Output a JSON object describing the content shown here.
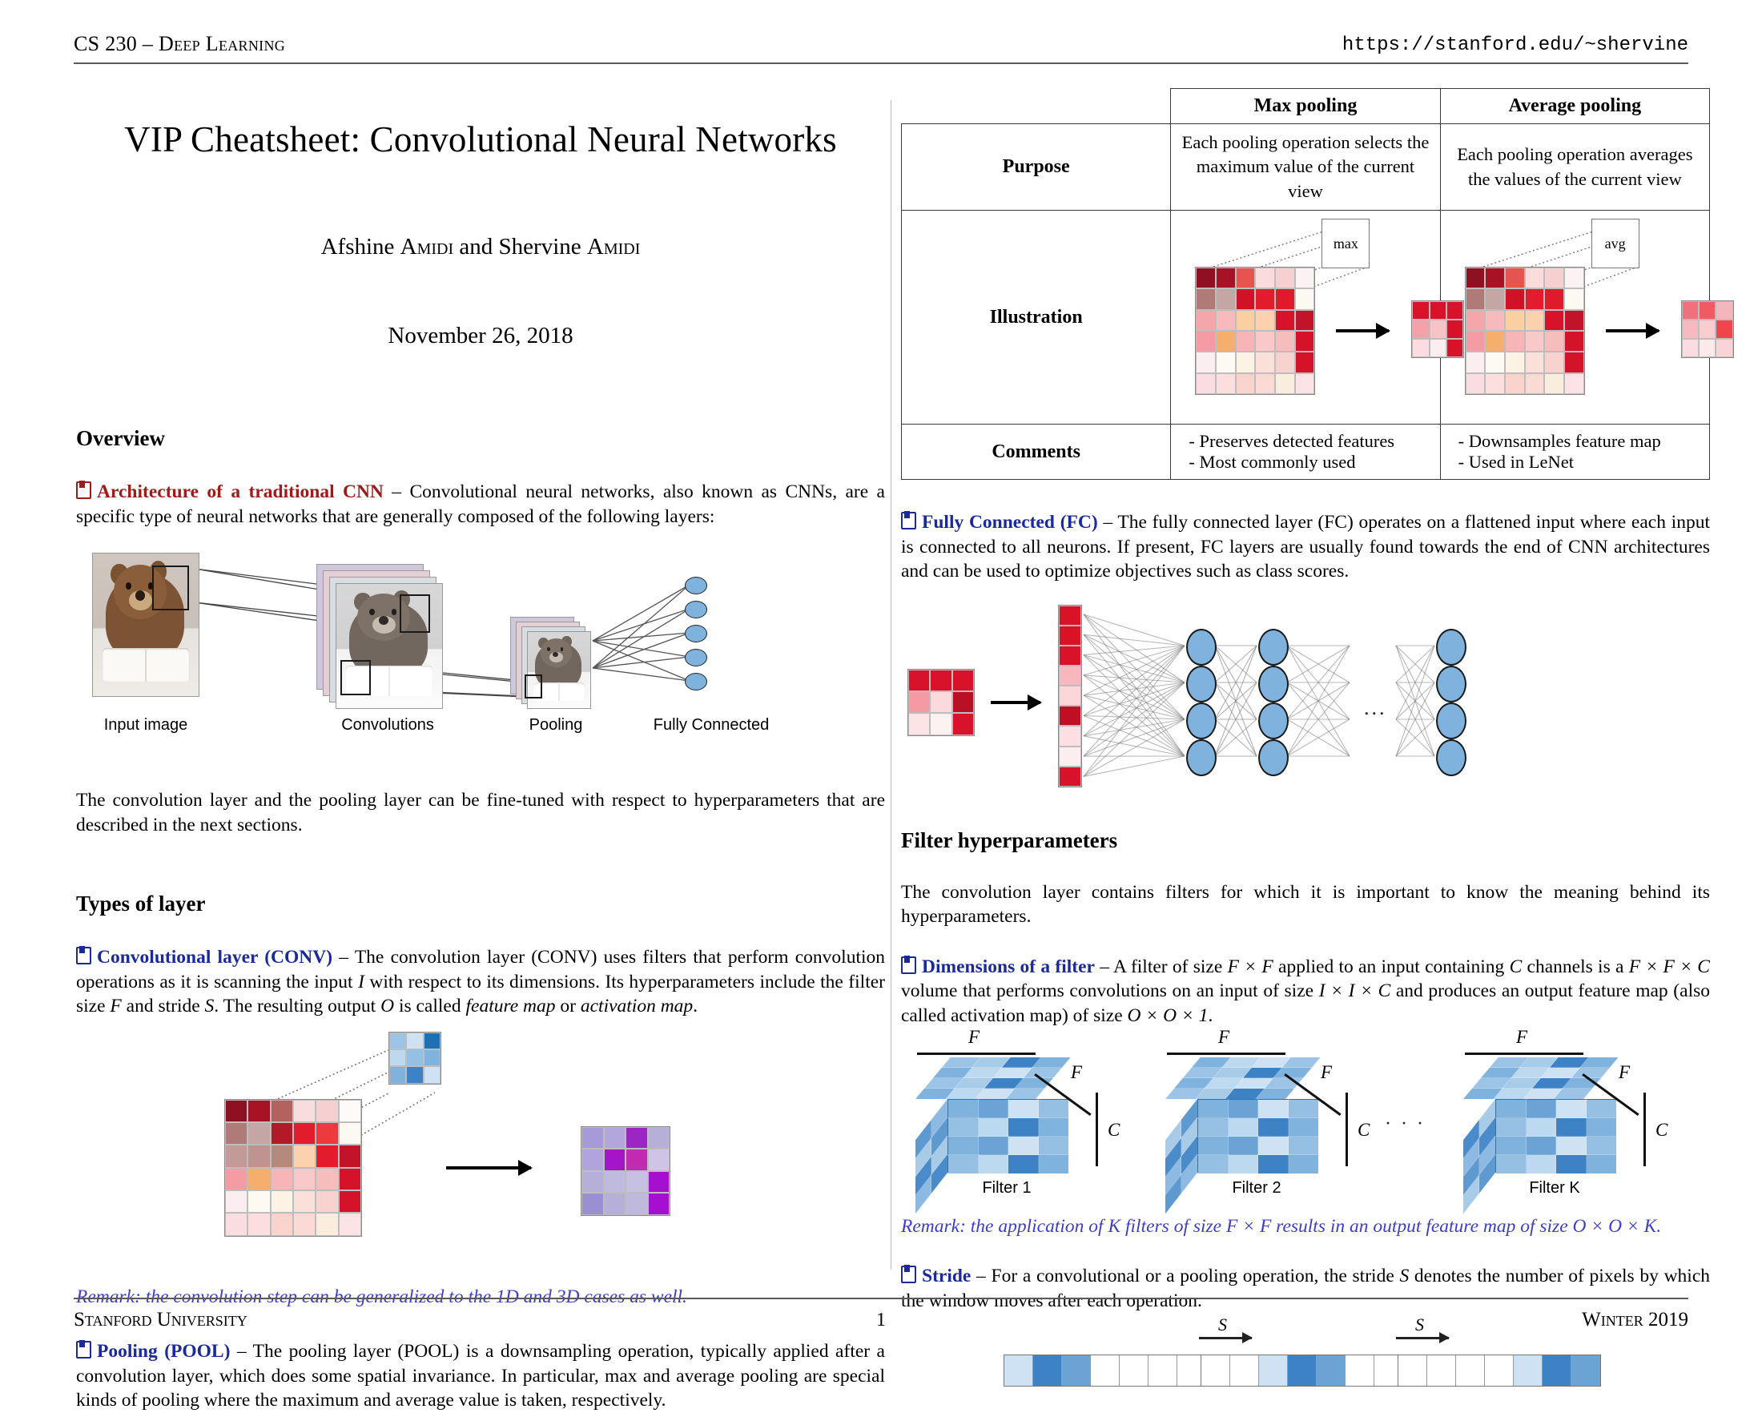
{
  "header": {
    "left": "CS 230 – Deep Learning",
    "right": "https://stanford.edu/~shervine"
  },
  "footer": {
    "left": "Stanford University",
    "page": "1",
    "right": "Winter 2019"
  },
  "title": {
    "main": "VIP Cheatsheet: Convolutional Neural Networks",
    "authors_pre": "Afshine ",
    "authors_name1": "Amidi",
    "authors_mid": " and Shervine ",
    "authors_name2": "Amidi",
    "date": "November 26, 2018"
  },
  "overview": {
    "heading": "Overview",
    "arch_kw": "Architecture of a traditional CNN",
    "arch_body": " – Convolutional neural networks, also known as CNNs, are a specific type of neural networks that are generally composed of the following layers:",
    "figure_labels": [
      "Input image",
      "Convolutions",
      "Pooling",
      "Fully Connected"
    ],
    "after_fig": "The convolution layer and the pooling layer can be fine-tuned with respect to hyperparameters that are described in the next sections."
  },
  "types_of_layer": {
    "heading": "Types of layer",
    "conv_kw": "Convolutional layer (CONV)",
    "conv_body_1": " – The convolution layer (CONV) uses filters that perform convolution operations as it is scanning the input ",
    "conv_I": "I",
    "conv_body_2": " with respect to its dimensions. Its hyperparameters include the filter size ",
    "conv_F": "F",
    "conv_body_3": " and stride ",
    "conv_S": "S",
    "conv_body_4": ". The resulting output ",
    "conv_O": "O",
    "conv_body_5": " is called ",
    "conv_em1": "feature map",
    "conv_body_6": " or ",
    "conv_em2": "activation map",
    "conv_body_7": ".",
    "conv_remark": "Remark: the convolution step can be generalized to the 1D and 3D cases as well.",
    "pool_kw": "Pooling (POOL)",
    "pool_body": " – The pooling layer (POOL) is a downsampling operation, typically applied after a convolution layer, which does some spatial invariance. In particular, max and average pooling are special kinds of pooling where the maximum and average value is taken, respectively."
  },
  "pooling_table": {
    "columns": [
      "Max pooling",
      "Average pooling"
    ],
    "rows": [
      {
        "label": "Purpose",
        "max": "Each pooling operation selects the maximum value of the current view",
        "avg": "Each pooling operation averages the values of the current view"
      },
      {
        "label": "Illustration",
        "max_tag": "max",
        "avg_tag": "avg"
      },
      {
        "label": "Comments",
        "max_lines": [
          "- Preserves detected features",
          "- Most commonly used"
        ],
        "avg_lines": [
          "- Downsamples feature map",
          "- Used in LeNet"
        ]
      }
    ]
  },
  "fully_connected": {
    "kw": "Fully Connected (FC)",
    "body": " – The fully connected layer (FC) operates on a flattened input where each input is connected to all neurons. If present, FC layers are usually found towards the end of CNN architectures and can be used to optimize objectives such as class scores.",
    "ellipsis": "..."
  },
  "filter_hyperparameters": {
    "heading": "Filter hyperparameters",
    "intro": "The convolution layer contains filters for which it is important to know the meaning behind its hyperparameters.",
    "dims_kw": "Dimensions of a filter",
    "dims_body_1": " – A filter of size ",
    "dims_FxF": "F × F",
    "dims_body_2": " applied to an input containing ",
    "dims_C": "C",
    "dims_body_3": " channels is a ",
    "dims_FxFxC": "F × F × C",
    "dims_body_4": " volume that performs convolutions on an input of size ",
    "dims_IxIxC": "I × I × C",
    "dims_body_5": " and produces an output feature map (also called activation map) of size ",
    "dims_OxOx1": "O × O × 1",
    "dims_body_6": ".",
    "cube_labels": [
      "Filter 1",
      "Filter 2",
      "Filter K"
    ],
    "cube_ellipsis": "· · ·",
    "dim_F": "F",
    "dim_C": "C",
    "remark": "Remark: the application of K filters of size F × F results in an output feature map of size O × O × K.",
    "stride_kw": "Stride",
    "stride_body_1": " – For a convolutional or a pooling operation, the stride ",
    "stride_S": "S",
    "stride_body_2": " denotes the number of pixels by which the window moves after each operation.",
    "stride_label": "S"
  },
  "colors": {
    "kw_red": "#a01a1a",
    "kw_blue": "#1a2a9c",
    "remark_blue": "#3d3dc8",
    "neuron_blue": "#7fb2dd",
    "heatmap_red": "#cf0a20",
    "filter_blue": "#3c82c4"
  },
  "chart_data": {
    "type": "heatmap",
    "max_pool_input": [
      [
        "#8f1020",
        "#a81225",
        "#e6544f",
        "#fadcdc",
        "#f6cfd0",
        "#fbf3f3"
      ],
      [
        "#b07a78",
        "#c4a7a4",
        "#d01227",
        "#e21c2c",
        "#df1a2a",
        "#fcf9f2"
      ],
      [
        "#f4a6ab",
        "#f8b9bc",
        "#fbcfa2",
        "#fbd2ad",
        "#d81228",
        "#c2132a"
      ],
      [
        "#f59ba3",
        "#f5ae6c",
        "#f7b5b7",
        "#f9c9c9",
        "#f6bdbd",
        "#d4132a"
      ],
      [
        "#fbeef0",
        "#fdfaf2",
        "#fdf3e4",
        "#fae0d8",
        "#f8d2ce",
        "#d4132a"
      ],
      [
        "#fadde0",
        "#fbdedd",
        "#fbd3cd",
        "#fbd9d4",
        "#fbeddd",
        "#fbe3e6"
      ]
    ],
    "max_pool_output": [
      [
        "#d7122a",
        "#d7122a",
        "#d7122a"
      ],
      [
        "#f6a0a9",
        "#f7c3c6",
        "#d7122a"
      ],
      [
        "#fbdce0",
        "#fbeef0",
        "#d7122a"
      ]
    ],
    "avg_pool_output": [
      [
        "#f0707c",
        "#ef5a63",
        "#f3b7bb"
      ],
      [
        "#f7b9bd",
        "#f9ccd0",
        "#f0454f"
      ],
      [
        "#fbdce0",
        "#fbe9ec",
        "#fad3d6"
      ]
    ],
    "conv_input": [
      [
        "#8f1020",
        "#a81225",
        "#b4625d",
        "#fadcdc",
        "#f6cfd0",
        "#fdfaf8"
      ],
      [
        "#b07a78",
        "#c4a7a4",
        "#b21a28",
        "#e21c2c",
        "#ee3a3f",
        "#fcf9f2"
      ],
      [
        "#c39a98",
        "#bf9390",
        "#b58a7c",
        "#fbd2ad",
        "#e21c2c",
        "#c2132a"
      ],
      [
        "#f59ba3",
        "#f5ae6c",
        "#f7b5b7",
        "#f9c9c9",
        "#f6bdbd",
        "#d4132a"
      ],
      [
        "#fbeef0",
        "#fdfaf2",
        "#fdf3e4",
        "#fae0d8",
        "#f8d2ce",
        "#d4132a"
      ],
      [
        "#fadde0",
        "#fbdedd",
        "#fbd3cd",
        "#fbd9d4",
        "#fbeddd",
        "#fbe3e6"
      ]
    ],
    "conv_filter": [
      [
        "#9cc4e6",
        "#cfe2f3",
        "#1f6fb5"
      ],
      [
        "#bdd9ef",
        "#95c0e4",
        "#7fb2dd"
      ],
      [
        "#7fb2dd",
        "#3c82c4",
        "#cfe2f3"
      ]
    ],
    "conv_output": [
      [
        "#a79ad8",
        "#b3a6de",
        "#9b26c4",
        "#b6b0d9"
      ],
      [
        "#b1a3dd",
        "#a515c8",
        "#c22ab0",
        "#cfc4e6"
      ],
      [
        "#b6b0d9",
        "#c0bade",
        "#c6c0e2",
        "#a50fd0"
      ],
      [
        "#9a8fd0",
        "#b6b0d9",
        "#bfb9dd",
        "#a50fd0"
      ]
    ],
    "fc_flat_column": [
      "#da1226",
      "#da1226",
      "#d9122a",
      "#f7b7bc",
      "#fbd7d9",
      "#c00f24",
      "#fbdfe2",
      "#fbeef0",
      "#d7122a"
    ],
    "fc_input_patch": [
      [
        "#d7122a",
        "#d7122a",
        "#d7122a"
      ],
      [
        "#f59aa2",
        "#fbd9dc",
        "#ba1026"
      ],
      [
        "#fbe3e6",
        "#fdf1f2",
        "#d7122a"
      ]
    ],
    "fc_layer_sizes": [
      4,
      4,
      4
    ],
    "stride_strips": [
      [
        "#cfe2f3",
        "#3c82c4",
        "#6aa3d4",
        "#ffffff",
        "#ffffff",
        "#ffffff",
        "#ffffff"
      ],
      [
        "#ffffff",
        "#ffffff",
        "#cfe2f3",
        "#3c82c4",
        "#6aa3d4",
        "#ffffff",
        "#ffffff"
      ],
      [
        "#ffffff",
        "#ffffff",
        "#ffffff",
        "#ffffff",
        "#cfe2f3",
        "#3c82c4",
        "#6aa3d4"
      ]
    ]
  }
}
